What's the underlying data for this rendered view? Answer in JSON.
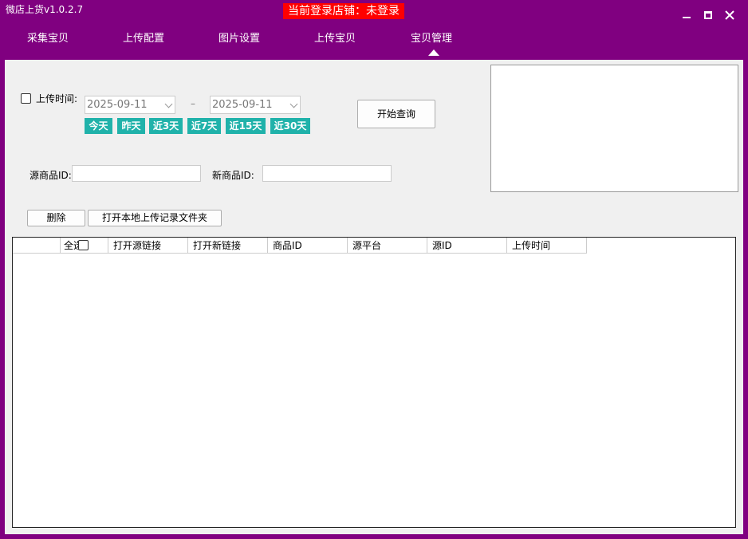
{
  "app": {
    "title": "微店上货v1.0.2.7",
    "login_status": "当前登录店铺：未登录",
    "accent_color": "#800080",
    "status_color": "#ff0000",
    "quick_btn_color": "#20b2aa"
  },
  "nav": {
    "tabs": [
      {
        "label": "采集宝贝"
      },
      {
        "label": "上传配置"
      },
      {
        "label": "图片设置"
      },
      {
        "label": "上传宝贝"
      },
      {
        "label": "宝贝管理",
        "active": true
      }
    ]
  },
  "filter": {
    "upload_time_label": "上传时间:",
    "upload_time_checked": false,
    "start_date": "2025-09-11",
    "date_separator": "–",
    "end_date": "2025-09-11",
    "quick_ranges": [
      "今天",
      "昨天",
      "近3天",
      "近7天",
      "近15天",
      "近30天"
    ],
    "query_button": "开始查询",
    "source_id_label": "源商品ID:",
    "source_id_value": "",
    "new_id_label": "新商品ID:",
    "new_id_value": ""
  },
  "actions": {
    "delete_button": "删除",
    "open_folder_button": "打开本地上传记录文件夹"
  },
  "table": {
    "columns": [
      "",
      "全选",
      "打开源链接",
      "打开新链接",
      "商品ID",
      "源平台",
      "源ID",
      "上传时间"
    ],
    "rows": []
  },
  "icons": {
    "minimize": "minimize-icon",
    "maximize": "maximize-icon",
    "close": "close-icon",
    "dropdown": "chevron-down-icon"
  }
}
